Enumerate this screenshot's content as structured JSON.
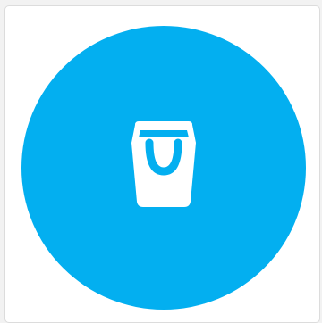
{
  "app": {
    "icon": "shopping-bag-icon",
    "colors": {
      "brand": "#03aff0",
      "icon": "#ffffff",
      "card_background": "#ffffff",
      "page_background": "#f2f2f2"
    }
  }
}
